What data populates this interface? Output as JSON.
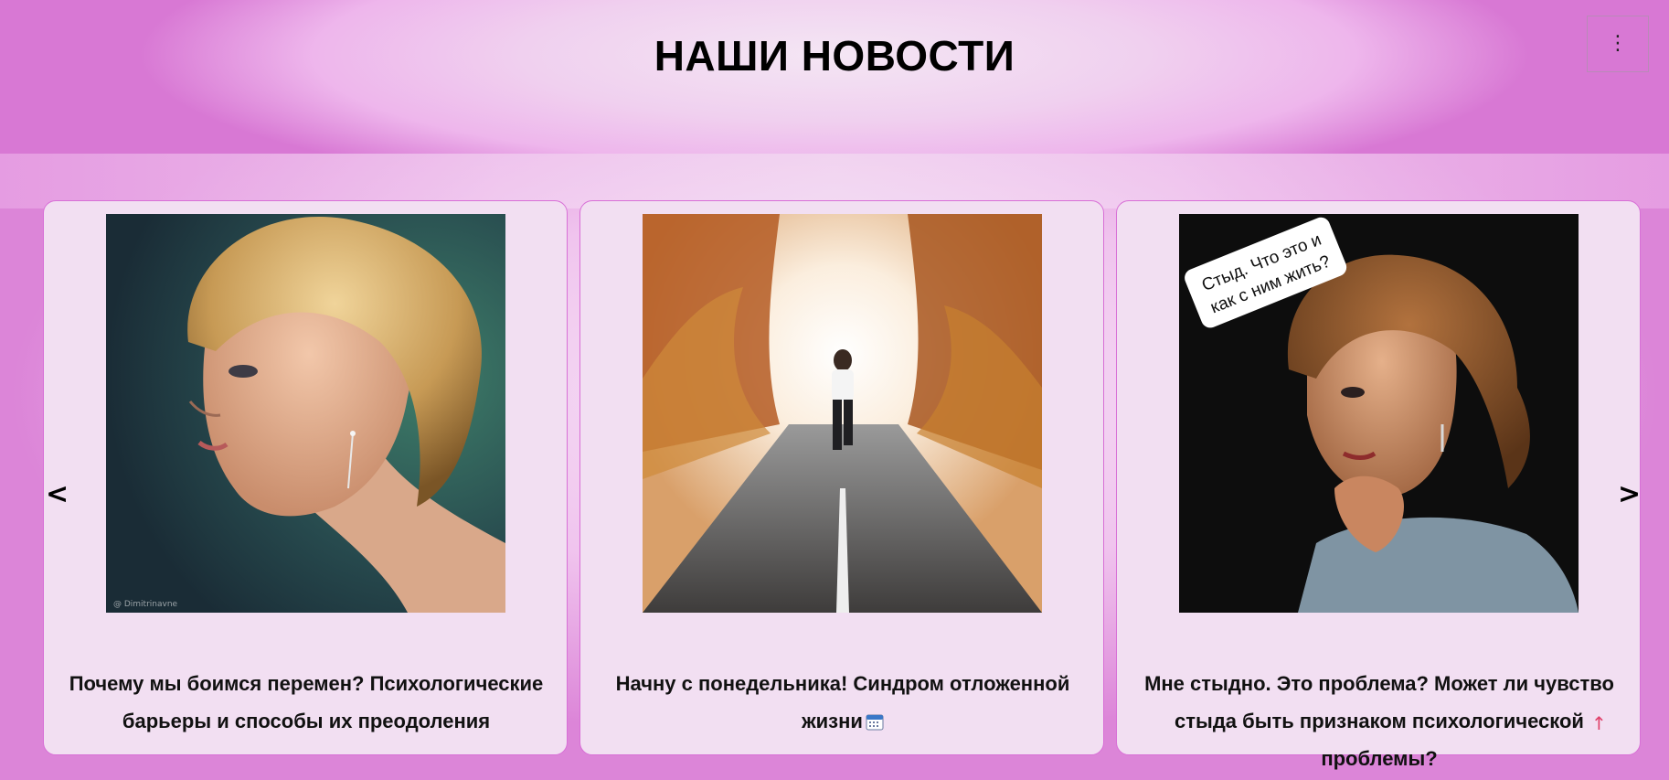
{
  "header": {
    "title": "НАШИ НОВОСТИ",
    "menu_icon": "⋮"
  },
  "carousel": {
    "prev_label": "<",
    "next_label": ">",
    "cards": [
      {
        "title": "Почему мы боимся перемен? Психологические барьеры и способы их преодоления",
        "image_icon": "woman-portrait-image",
        "image_caption": "@ Dimitrinavne"
      },
      {
        "title": "Начну с понедельника! Синдром отложенной жизни",
        "title_icon": "calendar-icon",
        "image_icon": "runner-road-image"
      },
      {
        "title": "Мне стыдно. Это проблема? Может ли чувство стыда быть признаком психологической проблемы?",
        "image_icon": "thinking-woman-image",
        "image_label": "Стыд. Что это и как с ним жить?"
      }
    ]
  },
  "scroll_top_label": "↑"
}
